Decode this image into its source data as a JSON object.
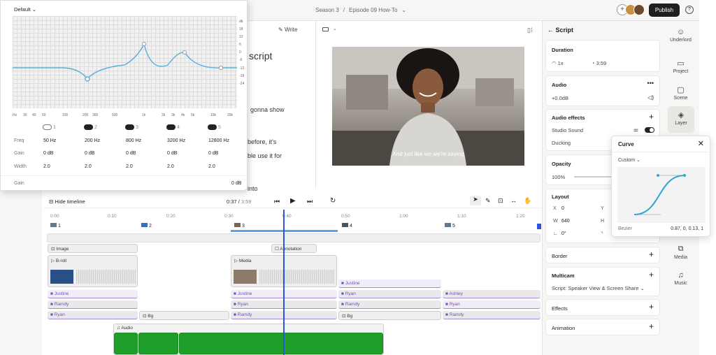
{
  "topbar": {
    "breadcrumb_parent": "Season 3",
    "breadcrumb_sep": "/",
    "breadcrumb_current": "Episode 09 How-To",
    "publish": "Publish"
  },
  "editor": {
    "write": "Write",
    "heading": "script",
    "lines": [
      "gonna show",
      "before, it's",
      "ble use it for",
      "into"
    ]
  },
  "video": {
    "caption": "And just like we we're saying"
  },
  "script_panel": {
    "title": "Script"
  },
  "duration": {
    "title": "Duration",
    "speed": "1x",
    "time": "3:59"
  },
  "audio": {
    "title": "Audio",
    "gain": "+0.0dB"
  },
  "audio_effects": {
    "title": "Audio effects",
    "studio": "Studio Sound",
    "ducking": "Ducking"
  },
  "opacity": {
    "title": "Opacity",
    "value": "100%"
  },
  "layout": {
    "title": "Layout",
    "x_label": "X",
    "x_value": "0",
    "y_label": "Y",
    "w_label": "W",
    "w_value": "640",
    "h_label": "H",
    "angle_value": "0°"
  },
  "border": {
    "title": "Border"
  },
  "multicam": {
    "title": "Multicam",
    "value": "Script: Speaker View & Screen Share"
  },
  "effects": {
    "title": "Effects"
  },
  "animation": {
    "title": "Animation"
  },
  "sidebar": {
    "items": [
      "Underlord",
      "Project",
      "Scene",
      "Layer",
      "Media",
      "Music"
    ]
  },
  "curve": {
    "title": "Curve",
    "preset": "Custom",
    "bezier_label": "Bezier",
    "bezier_value": "0.87, 0, 0.13, 1"
  },
  "eq": {
    "preset": "Default",
    "db_label": "db",
    "db_ticks": [
      "18",
      "12",
      "6",
      "0",
      "-6",
      "-12",
      "-18",
      "-24"
    ],
    "freq_ticks": [
      "Hz",
      "30",
      "40",
      "50",
      "100",
      "200",
      "300",
      "500",
      "1k",
      "2k",
      "3k",
      "4k",
      "5k",
      "10k",
      "20k"
    ],
    "band_nums": [
      "1",
      "2",
      "3",
      "4",
      "5"
    ],
    "row_labels": [
      "Freq",
      "Gain",
      "Width"
    ],
    "freq": [
      "50 Hz",
      "200 Hz",
      "800 Hz",
      "3200 Hz",
      "12800 Hz"
    ],
    "gain": [
      "0 dB",
      "0 dB",
      "0 dB",
      "0 dB",
      "0 dB"
    ],
    "width": [
      "2.0",
      "2.0",
      "2.0",
      "2.0",
      "2.0"
    ],
    "master_label": "Gain",
    "master_value": "0 dB"
  },
  "timeline": {
    "hide": "Hide timeline",
    "current": "0:37",
    "sep": "/",
    "total": "3:59",
    "ruler": [
      "0:00",
      "0:10",
      "0:20",
      "0:30",
      "0:40",
      "0:50",
      "1:00",
      "1:10",
      "1:20"
    ],
    "scenes": [
      "1",
      "2",
      "3",
      "4",
      "5"
    ],
    "clips": {
      "image": "Image",
      "annotation": "Annotation",
      "broll": "B-roll",
      "media": "Media",
      "audio": "Audio",
      "bg": "Bg",
      "justine": "Justine",
      "ramdy": "Ramdy",
      "ryan": "Ryan",
      "ashley": "Ashley"
    }
  },
  "colors": {
    "accent": "#2c55d8",
    "eq_curve": "#5ab0d8",
    "audio_green": "#1f9f2a",
    "publish_bg": "#1f1f1f"
  }
}
